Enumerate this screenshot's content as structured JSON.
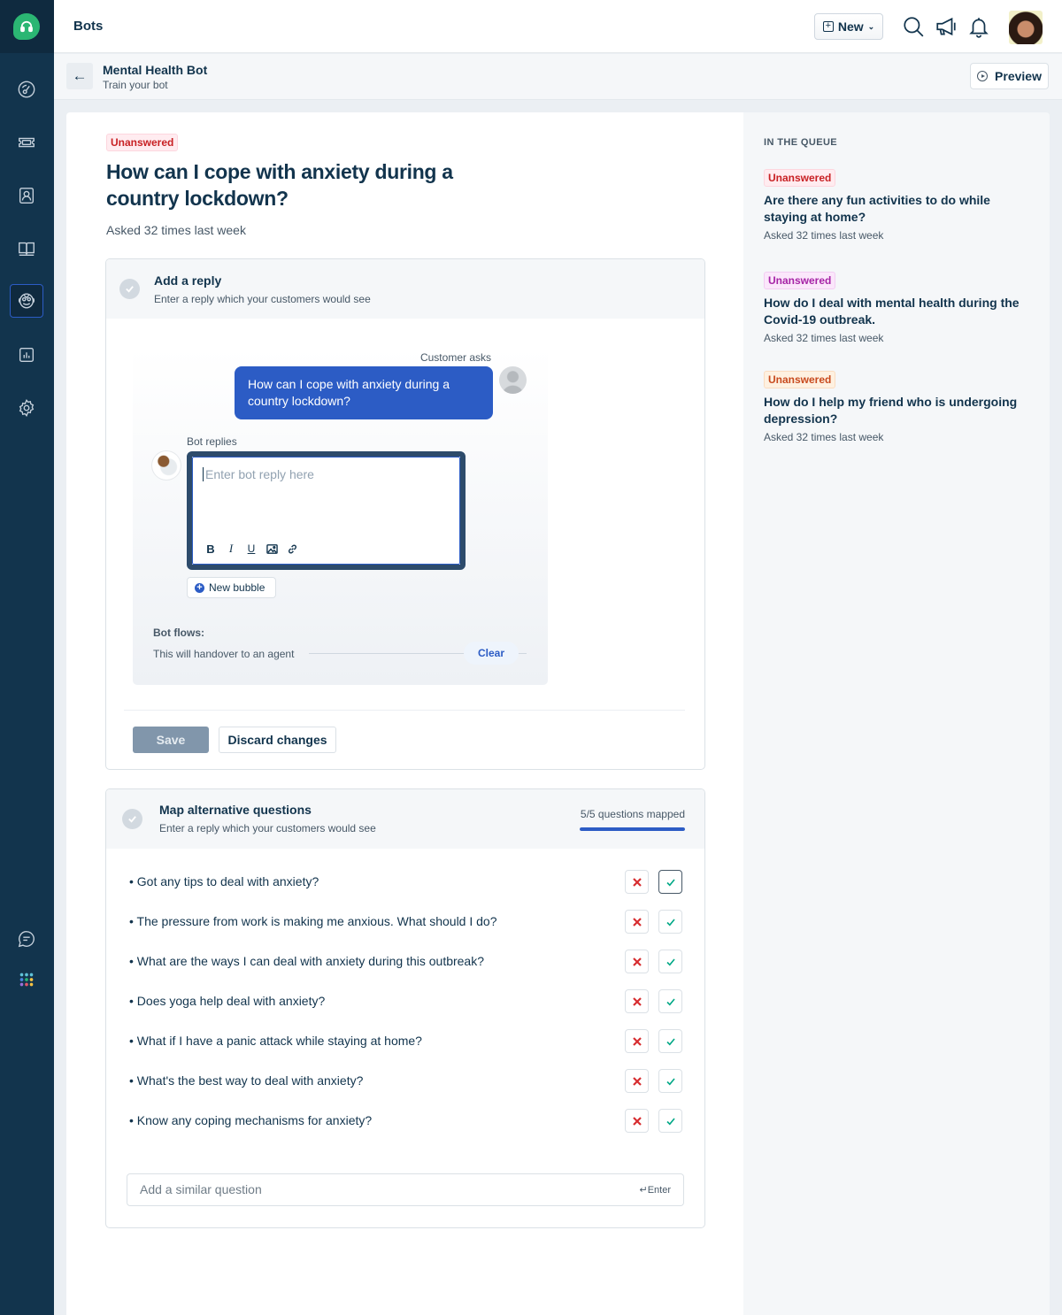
{
  "app": {
    "page_title": "Bots",
    "brand_color": "#2bb673",
    "accent_color": "#2c5cc5"
  },
  "sidebar": {
    "items": [
      {
        "name": "dashboard",
        "icon": "gauge-icon"
      },
      {
        "name": "tickets",
        "icon": "ticket-icon"
      },
      {
        "name": "contacts",
        "icon": "contact-icon"
      },
      {
        "name": "solutions",
        "icon": "book-icon"
      },
      {
        "name": "bots",
        "icon": "bot-icon",
        "active": true
      },
      {
        "name": "reports",
        "icon": "chart-icon"
      },
      {
        "name": "admin",
        "icon": "gear-icon"
      }
    ],
    "bottom_items": [
      {
        "name": "chat",
        "icon": "chat-icon"
      },
      {
        "name": "apps",
        "icon": "apps-grid-icon"
      }
    ]
  },
  "topbar": {
    "new_label": "New"
  },
  "subheader": {
    "title": "Mental Health Bot",
    "subtitle": "Train your bot",
    "preview_label": "Preview"
  },
  "question": {
    "status": "Unanswered",
    "title": "How can I cope with anxiety during a country lockdown?",
    "asked": "Asked 32 times last week"
  },
  "reply_section": {
    "title": "Add a reply",
    "subtitle": "Enter a reply which your customers would see",
    "customer_label": "Customer asks",
    "customer_message": "How can I cope with anxiety during a country lockdown?",
    "bot_label": "Bot replies",
    "editor_placeholder": "Enter bot reply here",
    "editor_value": "",
    "new_bubble_label": "New bubble",
    "flows_label": "Bot flows:",
    "flows_text": "This will handover to an agent",
    "clear_label": "Clear",
    "save_label": "Save",
    "discard_label": "Discard changes"
  },
  "map_section": {
    "title": "Map alternative questions",
    "subtitle": "Enter a reply which your customers would see",
    "mapped_label": "5/5 questions mapped",
    "mapped_progress": 1.0,
    "questions": [
      "Got any tips to deal with anxiety?",
      "The pressure from work is making me anxious. What should I do?",
      "What are the ways I can deal with anxiety during this outbreak?",
      "Does yoga help deal with anxiety?",
      "What if I have a panic attack while staying at home?",
      "What's the best way to deal with anxiety?",
      "Know any coping mechanisms for anxiety?"
    ],
    "similar_placeholder": "Add a similar question",
    "similar_value": "",
    "enter_hint": "↵Enter"
  },
  "queue": {
    "title": "IN THE QUEUE",
    "items": [
      {
        "status": "Unanswered",
        "status_color": "red",
        "title": "Are there any fun activities to do while staying at home?",
        "asked": "Asked 32 times last week"
      },
      {
        "status": "Unanswered",
        "status_color": "purple",
        "title": "How do I deal with mental health during the Covid-19 outbreak.",
        "asked": "Asked 32 times last week"
      },
      {
        "status": "Unanswered",
        "status_color": "orange",
        "title": "How do I help my friend who is undergoing depression?",
        "asked": "Asked 32 times last week"
      }
    ]
  }
}
